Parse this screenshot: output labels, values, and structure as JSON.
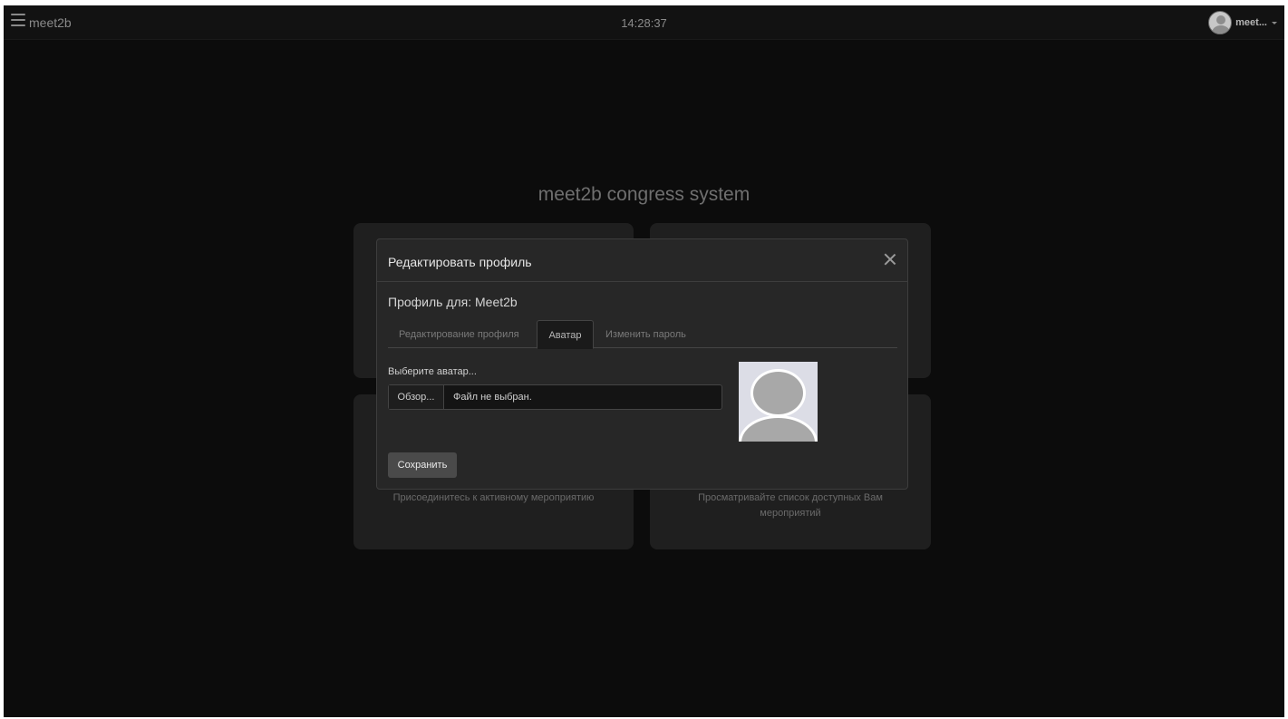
{
  "topbar": {
    "brand": "meet2b",
    "clock": "14:28:37",
    "user_name": "meet..."
  },
  "page": {
    "title": "meet2b congress system"
  },
  "cards": [
    {
      "text": ""
    },
    {
      "text": ""
    },
    {
      "text": "Присоединитесь к активному мероприятию"
    },
    {
      "text_line1": "Просматривайте список доступных Вам",
      "text_line2": "мероприятий"
    }
  ],
  "modal": {
    "title": "Редактировать профиль",
    "profile_for": "Профиль для: Meet2b",
    "tabs": [
      {
        "label": "Редактирование профиля",
        "active": false
      },
      {
        "label": "Аватар",
        "active": true
      },
      {
        "label": "Изменить пароль",
        "active": false
      }
    ],
    "field_label": "Выберите аватар...",
    "browse_label": "Обзор...",
    "file_status": "Файл не выбран.",
    "save_label": "Сохранить"
  },
  "colors": {
    "background": "#0c0c0c",
    "topbar": "#121212",
    "card": "#1f1f1f",
    "modal": "#272727",
    "save_button": "#4a4a4a"
  },
  "icons": {
    "menu": "hamburger-icon",
    "close": "close-icon",
    "user": "user-avatar-icon",
    "caret": "caret-down-icon"
  }
}
